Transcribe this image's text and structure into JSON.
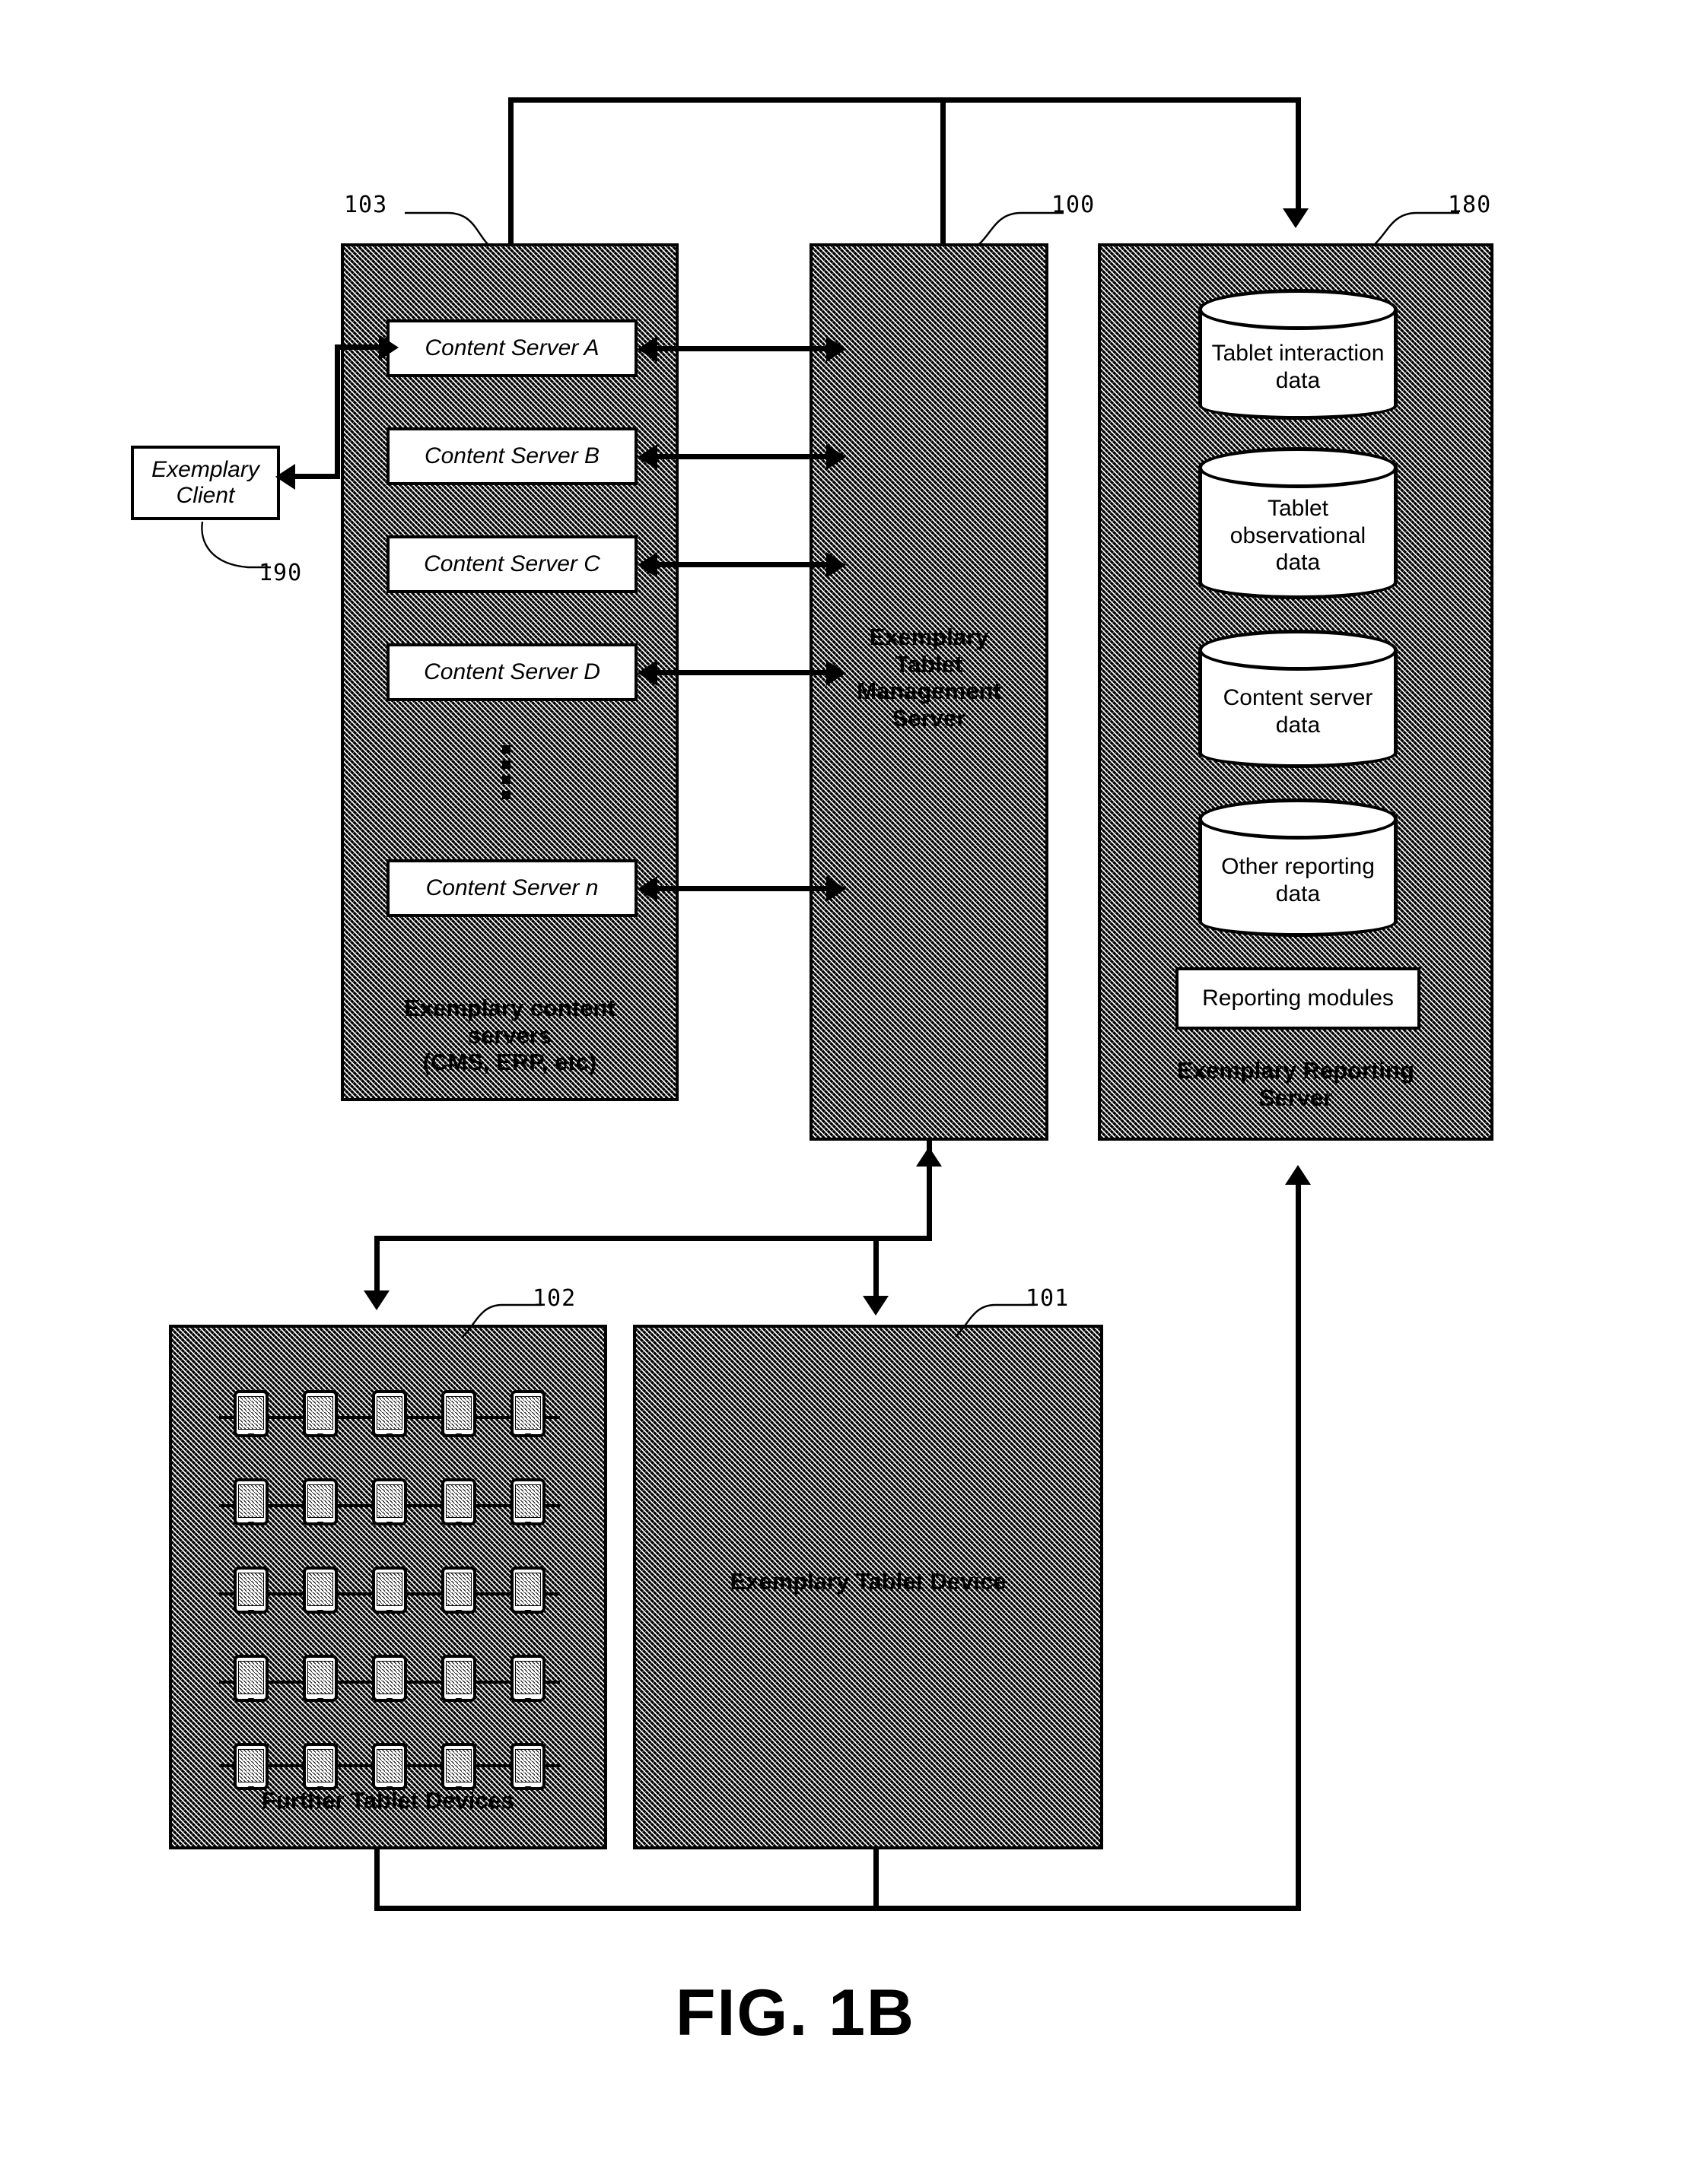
{
  "figure": {
    "caption": "FIG. 1B"
  },
  "content_servers_group": {
    "ref": "103",
    "title_lines": [
      "Exemplary content",
      "servers",
      "(CMS, ERP, etc)"
    ],
    "servers": [
      {
        "label": "Content Server A"
      },
      {
        "label": "Content Server B"
      },
      {
        "label": "Content Server C"
      },
      {
        "label": "Content Server D"
      },
      {
        "label": "Content Server n"
      }
    ],
    "ellipsis": "vertical-dots"
  },
  "client": {
    "ref": "190",
    "label_lines": [
      "Exemplary",
      "Client"
    ]
  },
  "management_server": {
    "ref": "100",
    "title_lines": [
      "Exemplary",
      "Tablet",
      "Management",
      "Server"
    ]
  },
  "reporting_server": {
    "ref": "180",
    "title_lines": [
      "Exemplary Reporting",
      "Server"
    ],
    "databases": [
      {
        "label_lines": [
          "Tablet interaction",
          "data"
        ],
        "icon": "database-cylinder-icon"
      },
      {
        "label_lines": [
          "Tablet",
          "observational",
          "data"
        ],
        "icon": "database-cylinder-icon"
      },
      {
        "label_lines": [
          "Content server",
          "data"
        ],
        "icon": "database-cylinder-icon"
      },
      {
        "label_lines": [
          "Other reporting",
          "data"
        ],
        "icon": "database-cylinder-icon"
      }
    ],
    "modules_box": {
      "label": "Reporting modules"
    }
  },
  "further_tablet_devices": {
    "ref": "102",
    "title": "Further Tablet Devices",
    "grid": {
      "rows": 5,
      "cols": 5,
      "icon": "tablet-device-icon"
    }
  },
  "exemplary_tablet_device": {
    "ref": "101",
    "title": "Exemplary Tablet Device"
  },
  "colors": {
    "ink": "#000000",
    "paper": "#ffffff"
  }
}
